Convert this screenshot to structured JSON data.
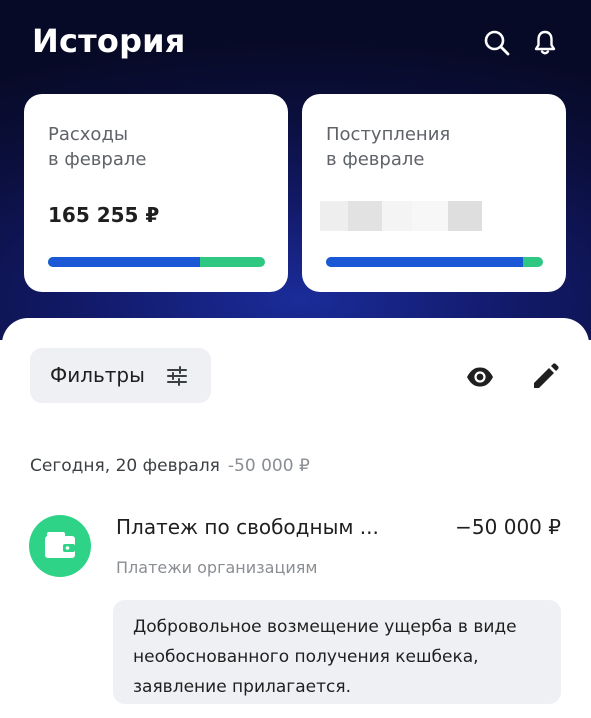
{
  "header": {
    "title": "История",
    "icons": {
      "search": "search-icon",
      "notifications": "bell-icon"
    }
  },
  "summary": {
    "expenses": {
      "label": "Расходы\nв феврале",
      "amount": "165 255 ₽",
      "bar_fraction": 0.7
    },
    "income": {
      "label": "Поступления\nв феврале",
      "amount_hidden": true,
      "bar_fraction": 0.91
    }
  },
  "toolbar": {
    "filters_label": "Фильтры",
    "filters_icon": "sliders-icon",
    "eye_icon": "eye-icon",
    "edit_icon": "pencil-icon"
  },
  "groups": [
    {
      "date": "Сегодня, 20 февраля",
      "total": "-50 000 ₽",
      "transactions": [
        {
          "title": "Платеж по свободным ...",
          "amount": "−50 000 ₽",
          "category": "Платежи организациям",
          "icon": "wallet-icon",
          "comment": "Добровольное возмещение ущерба в виде необоснованного получения кешбека, заявление прилагается."
        }
      ]
    }
  ],
  "colors": {
    "header_bg": "#0b0f3d",
    "bar_primary": "#1a58d6",
    "bar_secondary": "#2ec882",
    "tx_icon_bg": "#2ed387"
  }
}
